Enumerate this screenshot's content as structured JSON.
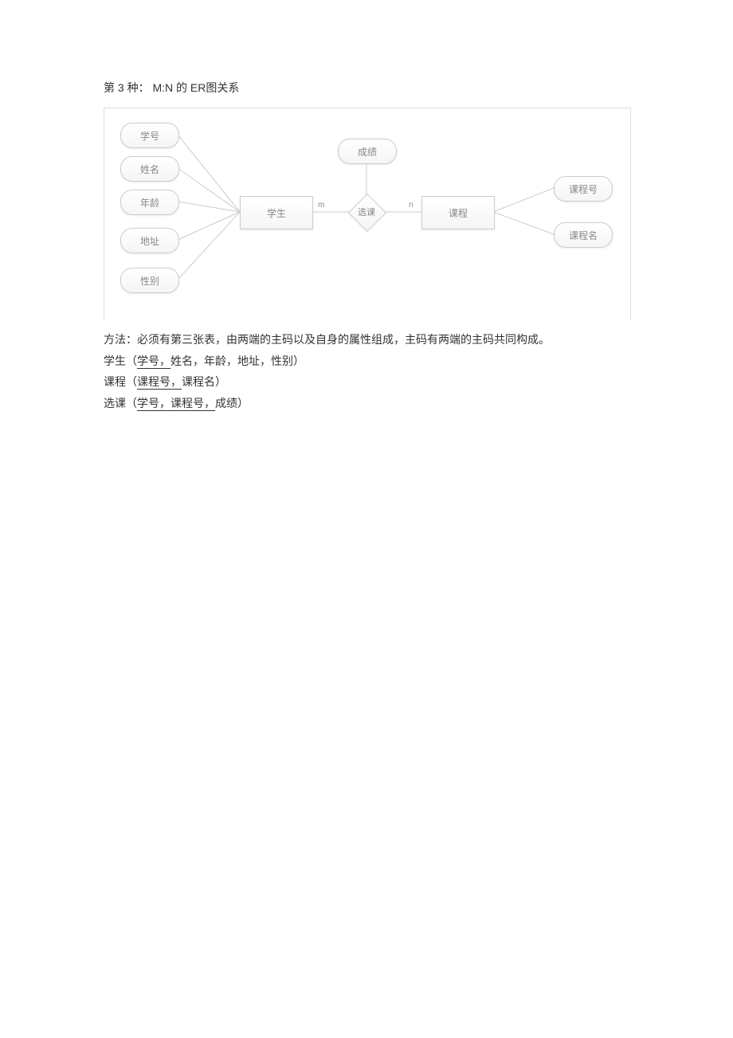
{
  "title": "第 3 种： M:N 的 ER图关系",
  "diagram": {
    "attrs_left": [
      "学号",
      "姓名",
      "年龄",
      "地址",
      "性别"
    ],
    "entity_student": "学生",
    "relation": "选课",
    "rel_attr": "成绩",
    "card_left": "m",
    "card_right": "n",
    "entity_course": "课程",
    "attrs_right": [
      "课程号",
      "课程名"
    ]
  },
  "desc": {
    "method": "方法：必须有第三张表，由两端的主码以及自身的属性组成，主码有两端的主码共同构成。",
    "student_label": "学生（",
    "student_key": "学号，",
    "student_rest": "姓名，年龄，地址，性别）",
    "course_label": "课程（",
    "course_key": "课程号，",
    "course_rest": "课程名）",
    "select_label": "选课（",
    "select_key": "学号，课程号，",
    "select_rest": "成绩）"
  }
}
